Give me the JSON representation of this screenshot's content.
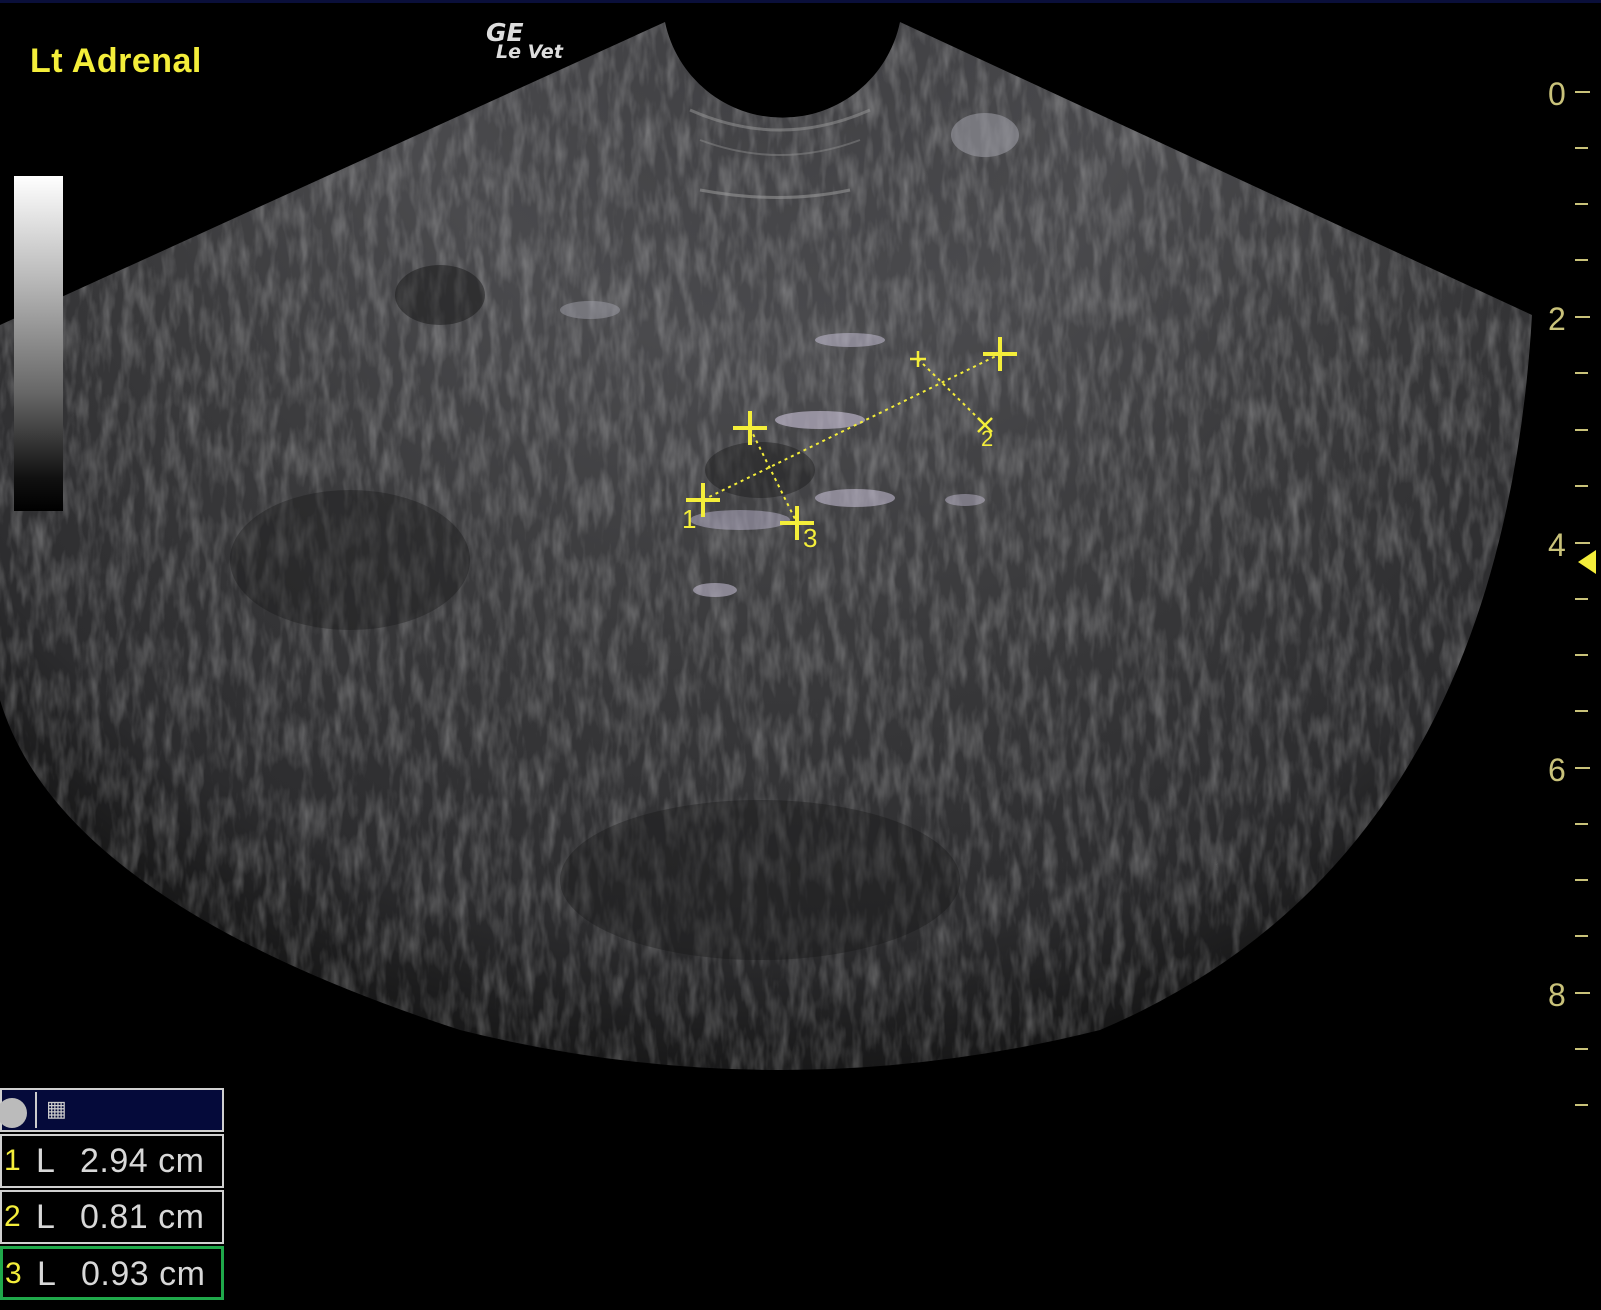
{
  "image_label": "Lt Adrenal",
  "logo": {
    "brand": "GE",
    "model": "Le Vet"
  },
  "depth_scale": {
    "labels": [
      "0",
      "2",
      "4",
      "6",
      "8"
    ]
  },
  "caliper_labels": [
    "1",
    "2",
    "3"
  ],
  "measurement_panel": {
    "icons": [
      "circle-icon",
      "caliper-tool-icon"
    ],
    "rows": [
      {
        "index": "1",
        "type": "L",
        "value": "2.94 cm",
        "selected": false
      },
      {
        "index": "2",
        "type": "L",
        "value": "0.81 cm",
        "selected": false
      },
      {
        "index": "3",
        "type": "L",
        "value": "0.93 cm",
        "selected": true
      }
    ]
  },
  "colors": {
    "annotation": "#f4ee3a",
    "scale_text": "#c9c27a",
    "selected_border": "#1fa84a",
    "panel_header": "#050a3a"
  }
}
